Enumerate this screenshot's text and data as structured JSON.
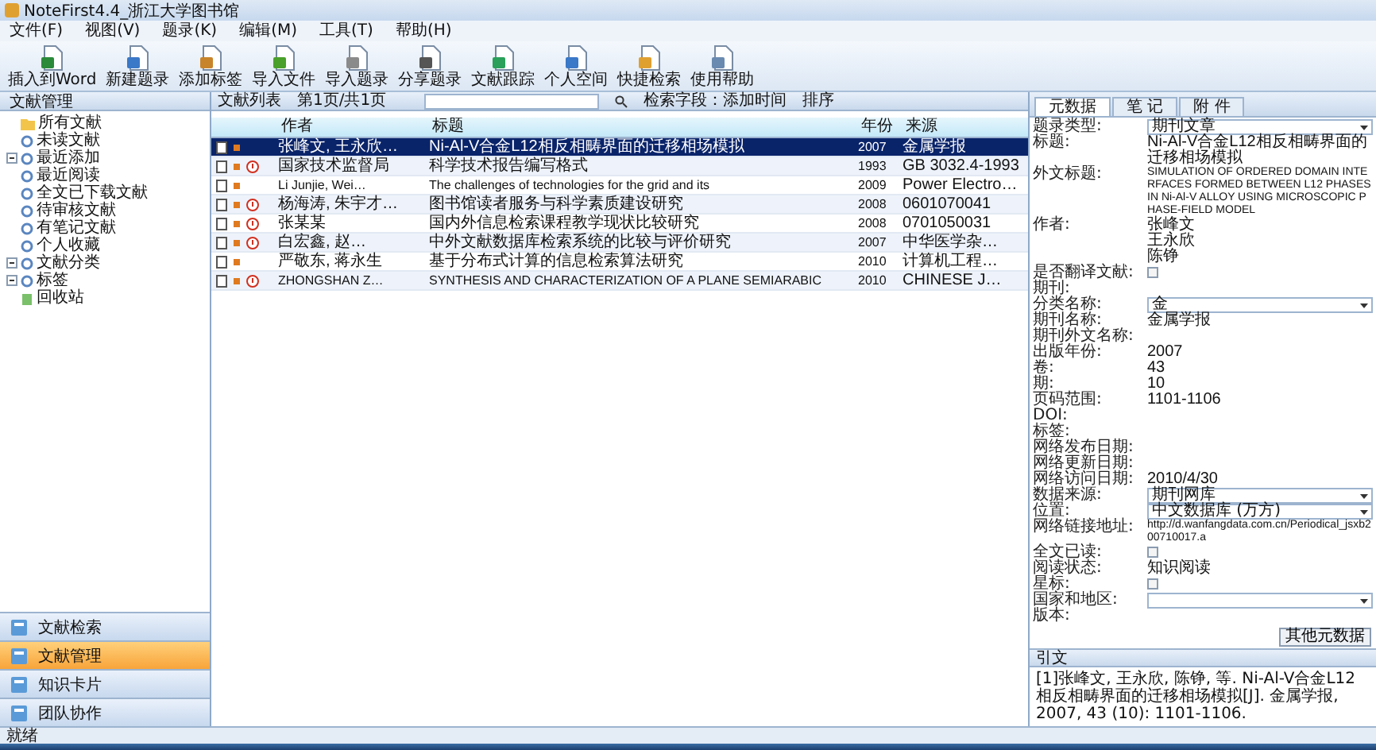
{
  "window": {
    "title": "NoteFirst4.4_浙江大学图书馆"
  },
  "menu": [
    "文件(F)",
    "视图(V)",
    "题录(K)",
    "编辑(M)",
    "工具(T)",
    "帮助(H)"
  ],
  "toolbar": [
    "插入到Word",
    "新建题录",
    "添加标签",
    "导入文件",
    "导入题录",
    "分享题录",
    "文献跟踪",
    "个人空间",
    "快捷检索",
    "使用帮助"
  ],
  "left": {
    "header": "文献管理",
    "tree": [
      {
        "label": "所有文献",
        "kind": "folder",
        "expanded": false
      },
      {
        "label": "未读文献",
        "kind": "node",
        "expanded": false
      },
      {
        "label": "最近添加",
        "kind": "node",
        "expanded": true
      },
      {
        "label": "最近阅读",
        "kind": "node",
        "expanded": false
      },
      {
        "label": "全文已下载文献",
        "kind": "node",
        "expanded": false
      },
      {
        "label": "待审核文献",
        "kind": "node",
        "expanded": false
      },
      {
        "label": "有笔记文献",
        "kind": "node",
        "expanded": false
      },
      {
        "label": "个人收藏",
        "kind": "node",
        "expanded": false
      },
      {
        "label": "文献分类",
        "kind": "node",
        "expanded": true
      },
      {
        "label": "标签",
        "kind": "node",
        "expanded": true
      },
      {
        "label": "回收站",
        "kind": "bin",
        "expanded": false
      }
    ],
    "nav": [
      {
        "label": "文献检索",
        "selected": false
      },
      {
        "label": "文献管理",
        "selected": true
      },
      {
        "label": "知识卡片",
        "selected": false
      },
      {
        "label": "团队协作",
        "selected": false
      }
    ]
  },
  "list_bar": {
    "label": "文献列表",
    "page": "第1页/共1页",
    "field": "检索字段：添加时间",
    "sort": "排序"
  },
  "table": {
    "columns": [
      "作者",
      "标题",
      "年份",
      "来源"
    ],
    "rows": [
      {
        "author": "张峰文, 王永欣…",
        "title": "Ni-Al-V合金L12相反相畴界面的迁移相场模拟",
        "year": "2007",
        "source": "金属学报",
        "selected": true,
        "important": false
      },
      {
        "author": "国家技术监督局",
        "title": "科学技术报告编写格式",
        "year": "1993",
        "source": "GB 3032.4-1993",
        "selected": false,
        "important": true
      },
      {
        "author": "Li Junjie, Wei…",
        "title": "The challenges of technologies for the grid and its",
        "year": "2009",
        "source": "Power Electro…",
        "selected": false,
        "important": false,
        "kind": "latin"
      },
      {
        "author": "杨海涛, 朱宇才…",
        "title": "图书馆读者服务与科学素质建设研究",
        "year": "2008",
        "source": "0601070041",
        "selected": false,
        "important": true
      },
      {
        "author": "张某某",
        "title": "国内外信息检索课程教学现状比较研究",
        "year": "2008",
        "source": "0701050031",
        "selected": false,
        "important": true
      },
      {
        "author": "白宏鑫, 赵…",
        "title": "中外文献数据库检索系统的比较与评价研究",
        "year": "2007",
        "source": "中华医学杂…",
        "selected": false,
        "important": true
      },
      {
        "author": "严敬东, 蒋永生",
        "title": "基于分布式计算的信息检索算法研究",
        "year": "2010",
        "source": "计算机工程…",
        "selected": false,
        "important": false
      },
      {
        "author": "ZHONGSHAN Z…",
        "title": "SYNTHESIS AND CHARACTERIZATION OF A PLANE SEMIARABIC",
        "year": "2010",
        "source": "CHINESE J…",
        "selected": false,
        "important": true,
        "kind": "latin"
      }
    ]
  },
  "details": {
    "tabs": [
      {
        "label": "元数据",
        "selected": true
      },
      {
        "label": "笔 记",
        "selected": false
      },
      {
        "label": "附 件",
        "selected": false
      }
    ],
    "fields": [
      {
        "label": "题录类型:",
        "kind": "select",
        "value": "期刊文章"
      },
      {
        "label": "标题:",
        "kind": "text",
        "value": "Ni-Al-V合金L12相反相畴界面的迁移相场模拟"
      },
      {
        "label": "外文标题:",
        "kind": "small",
        "value": "SIMULATION OF ORDERED DOMAIN INTERFACES FORMED BETWEEN L12 PHASES IN Ni-Al-V ALLOY USING MICROSCOPIC PHASE-FIELD MODEL"
      },
      {
        "label": "作者:",
        "kind": "lines",
        "lines": [
          "张峰文",
          "王永欣",
          "陈铮"
        ]
      },
      {
        "label": "是否翻译文献:",
        "kind": "checkbox",
        "checked": false
      },
      {
        "label": "期刊:",
        "kind": "text"
      },
      {
        "label": "分类名称:",
        "kind": "select",
        "value": "金"
      },
      {
        "label": "期刊名称:",
        "kind": "text",
        "value": "金属学报"
      },
      {
        "label": "期刊外文名称:",
        "kind": "text"
      },
      {
        "label": "出版年份:",
        "kind": "text",
        "value": "2007"
      },
      {
        "label": "卷:",
        "kind": "text",
        "value": "43"
      },
      {
        "label": "期:",
        "kind": "text",
        "value": "10"
      },
      {
        "label": "页码范围:",
        "kind": "text",
        "value": "1101-1106"
      },
      {
        "label": "DOI:",
        "kind": "text"
      },
      {
        "label": "标签:",
        "kind": "text"
      },
      {
        "label": "网络发布日期:",
        "kind": "text"
      },
      {
        "label": "网络更新日期:",
        "kind": "text"
      },
      {
        "label": "网络访问日期:",
        "kind": "text",
        "value": "2010/4/30"
      },
      {
        "label": "数据来源:",
        "kind": "select",
        "value": "期刊网库"
      },
      {
        "label": "位置:",
        "kind": "select",
        "value": "中文数据库 (万方)"
      },
      {
        "label": "网络链接地址:",
        "kind": "small",
        "value": "http://d.wanfangdata.com.cn/Periodical_jsxb200710017.a"
      },
      {
        "label": "全文已读:",
        "kind": "checkbox",
        "checked": false
      },
      {
        "label": "阅读状态:",
        "kind": "text",
        "value": "知识阅读"
      },
      {
        "label": "星标:",
        "kind": "checkbox",
        "checked": false
      },
      {
        "label": "国家和地区:",
        "kind": "select"
      },
      {
        "label": "版本:",
        "kind": "text"
      }
    ],
    "other_button": "其他元数据",
    "citation": {
      "header": "引文",
      "text": "[1]张峰文, 王永欣, 陈铮, 等. Ni-Al-V合金L12相反相畴界面的迁移相场模拟[J]. 金属学报, 2007, 43 (10): 1101-1106."
    }
  },
  "status_bar": "就绪"
}
